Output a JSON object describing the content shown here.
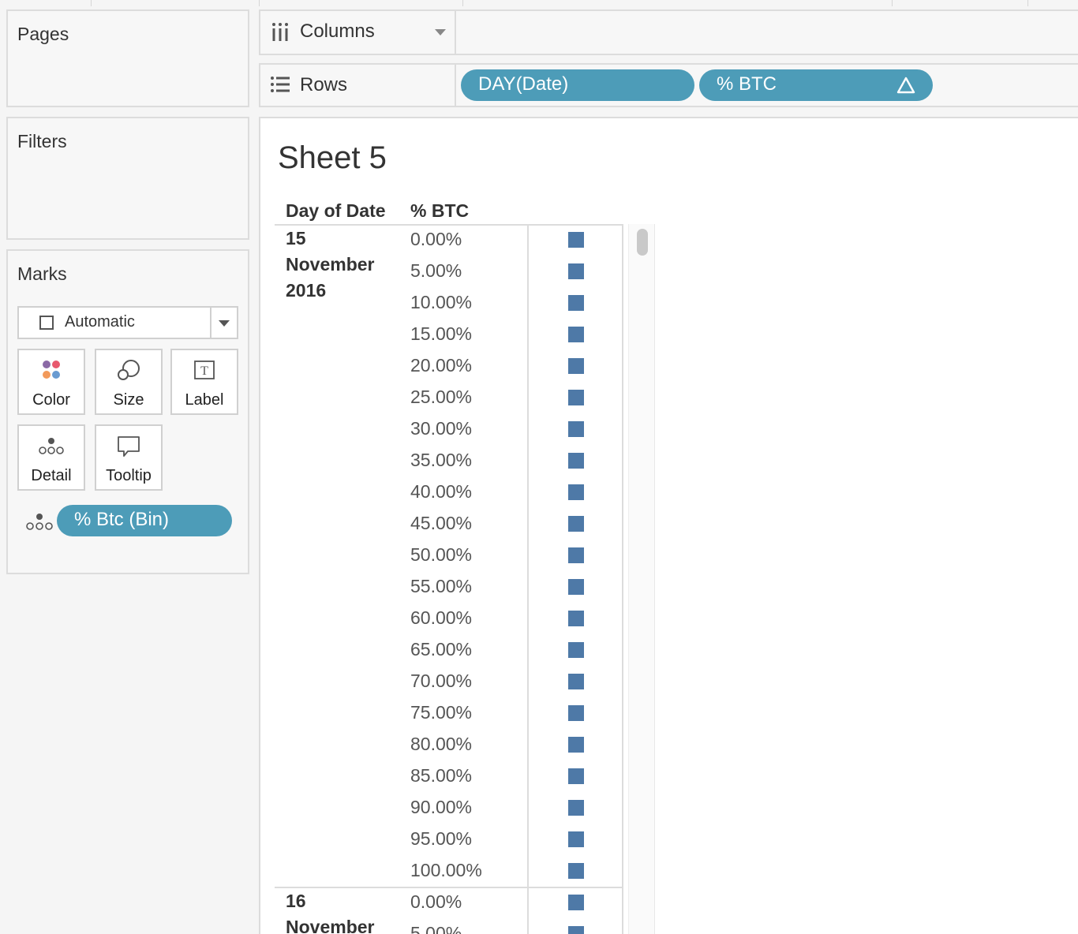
{
  "pages": {
    "title": "Pages"
  },
  "filters": {
    "title": "Filters"
  },
  "marks": {
    "title": "Marks",
    "mark_type": "Automatic",
    "buttons": {
      "color": "Color",
      "size": "Size",
      "label": "Label",
      "detail": "Detail",
      "tooltip": "Tooltip"
    },
    "detail_pill": "% Btc (Bin)"
  },
  "shelves": {
    "columns": {
      "label": "Columns"
    },
    "rows": {
      "label": "Rows",
      "pills": [
        "DAY(Date)",
        "% BTC"
      ]
    }
  },
  "sheet": {
    "title": "Sheet 5",
    "headers": {
      "date": "Day of Date",
      "value": "% BTC"
    },
    "groups": [
      {
        "date_lines": [
          "15",
          "November",
          "2016"
        ],
        "values": [
          "0.00%",
          "5.00%",
          "10.00%",
          "15.00%",
          "20.00%",
          "25.00%",
          "30.00%",
          "35.00%",
          "40.00%",
          "45.00%",
          "50.00%",
          "55.00%",
          "60.00%",
          "65.00%",
          "70.00%",
          "75.00%",
          "80.00%",
          "85.00%",
          "90.00%",
          "95.00%",
          "100.00%"
        ]
      },
      {
        "date_lines": [
          "16",
          "November"
        ],
        "values": [
          "0.00%",
          "5.00%"
        ]
      }
    ],
    "mark_color": "#4e79a7"
  },
  "colors": {
    "pill": "#4d9cb8"
  }
}
